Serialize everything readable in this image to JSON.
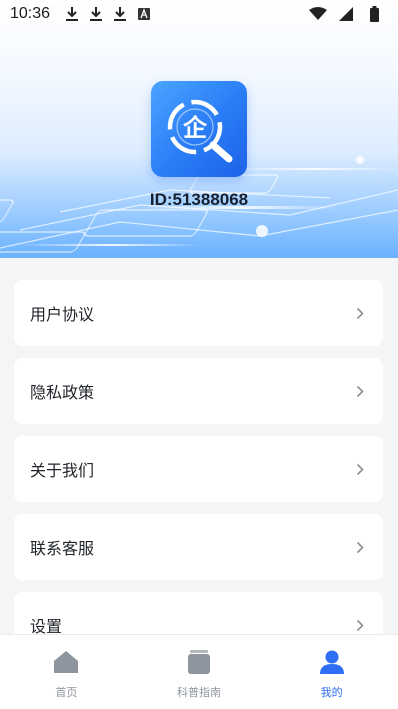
{
  "status_bar": {
    "time": "10:36",
    "left_icons": [
      "download-icon",
      "download-icon",
      "download-icon",
      "font-a-icon"
    ],
    "right_icons": [
      "wifi-icon",
      "signal-icon",
      "battery-icon"
    ]
  },
  "profile": {
    "logo_glyph": "企",
    "id_text": "ID:51388068"
  },
  "menu": {
    "items": [
      {
        "label": "用户协议"
      },
      {
        "label": "隐私政策"
      },
      {
        "label": "关于我们"
      },
      {
        "label": "联系客服"
      },
      {
        "label": "设置"
      }
    ]
  },
  "tabbar": {
    "tabs": [
      {
        "label": "首页",
        "icon": "home-icon",
        "active": false
      },
      {
        "label": "科普指南",
        "icon": "book-icon",
        "active": false
      },
      {
        "label": "我的",
        "icon": "user-icon",
        "active": true
      }
    ]
  },
  "colors": {
    "accent": "#2f6ff5",
    "inactive": "#8f959e",
    "background": "#f4f5f7",
    "card": "#ffffff"
  }
}
